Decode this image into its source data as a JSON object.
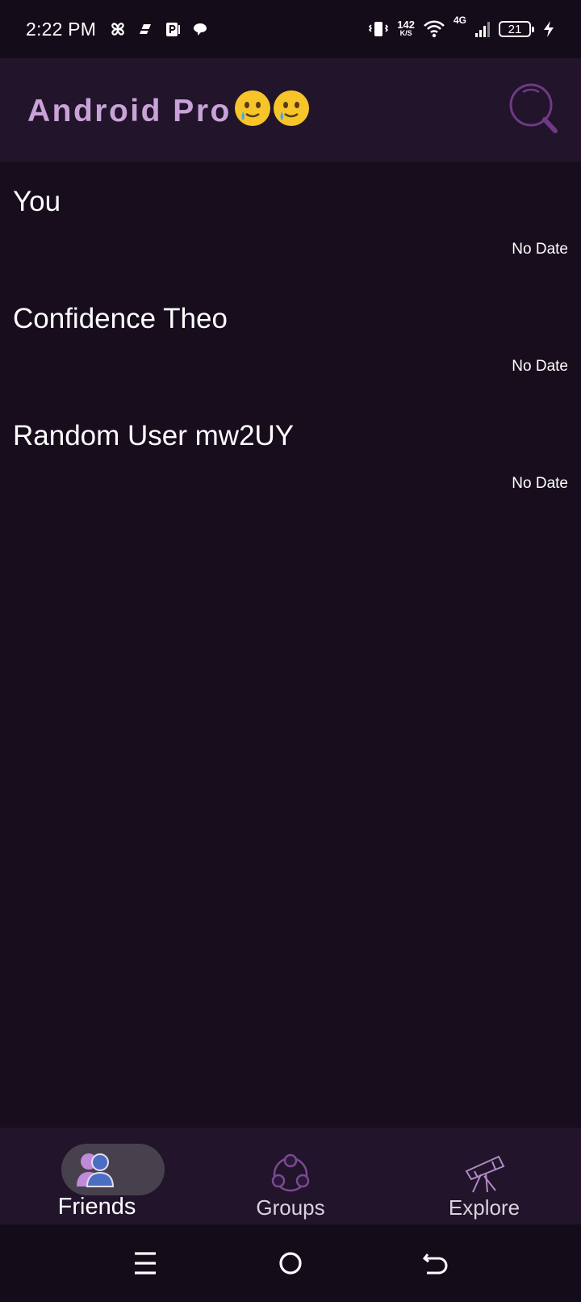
{
  "status_bar": {
    "time": "2:22 PM",
    "net_speed_value": "142",
    "net_speed_unit": "K/S",
    "network_type": "4G",
    "battery_level": "21",
    "left_icons": [
      "pinwheel-icon",
      "notification-app-icon",
      "parking-app-icon",
      "chat-bubble-icon"
    ],
    "right_icons": [
      "vibrate-icon",
      "wifi-icon",
      "signal-icon",
      "charging-bolt-icon"
    ]
  },
  "app_bar": {
    "title": "Android Pro",
    "title_emojis": [
      "smiling-face-with-tear",
      "smiling-face-with-tear"
    ],
    "title_color": "#c9a3d8",
    "search_icon": "search-icon"
  },
  "chats": [
    {
      "name": "You",
      "date": "No Date"
    },
    {
      "name": "Confidence Theo",
      "date": "No Date"
    },
    {
      "name": "Random User mw2UY",
      "date": "No Date"
    }
  ],
  "bottom_nav": {
    "items": [
      {
        "label": "Friends",
        "icon": "friends-icon",
        "active": true
      },
      {
        "label": "Groups",
        "icon": "groups-icon",
        "active": false
      },
      {
        "label": "Explore",
        "icon": "telescope-icon",
        "active": false
      }
    ]
  },
  "system_nav": {
    "icons": [
      "recents-icon",
      "home-icon",
      "back-icon"
    ]
  },
  "colors": {
    "background": "#170d1d",
    "app_bar": "#21142b",
    "accent": "#c9a3d8",
    "active_pill": "#47414e"
  }
}
